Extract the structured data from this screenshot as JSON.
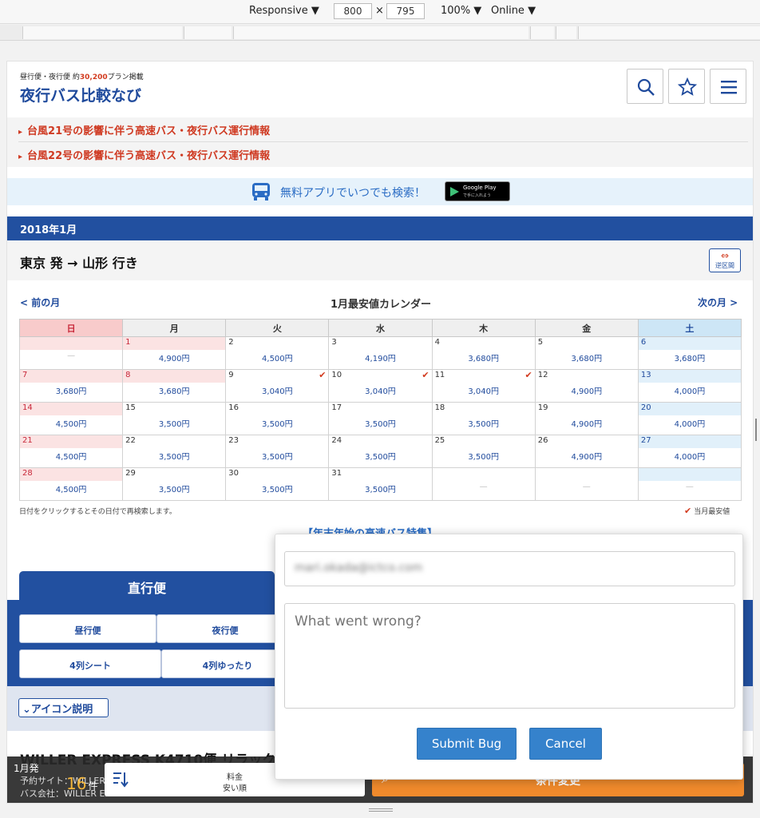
{
  "devtools": {
    "mode": "Responsive ▼",
    "width": "800",
    "height": "795",
    "times": "×",
    "zoom": "100% ▼",
    "network": "Online ▼"
  },
  "header": {
    "tagline_pre": "昼行便・夜行便 約",
    "tagline_count": "30,200",
    "tagline_post": "プラン掲載",
    "logo": "夜行バス比較なび",
    "icons": [
      "search-icon",
      "star-icon",
      "menu-icon"
    ]
  },
  "alerts": [
    "台風21号の影響に伴う高速バス・夜行バス運行情報",
    "台風22号の影響に伴う高速バス・夜行バス運行情報"
  ],
  "app_banner": {
    "text": "無料アプリでいつでも検索！",
    "store_line1": "Google Play",
    "store_line2": "で手に入れよう"
  },
  "month_label": "2018年1月",
  "route": "東京 発 → 山形 行き",
  "reverse_button": {
    "arrow": "⇔",
    "label": "逆区間"
  },
  "calendar": {
    "prev": "< 前の月",
    "next": "次の月 >",
    "title": "1月最安値カレンダー",
    "weekdays": [
      "日",
      "月",
      "火",
      "水",
      "木",
      "金",
      "土"
    ],
    "weeks": [
      [
        {
          "day": "",
          "price": "—",
          "type": "sun"
        },
        {
          "day": "1",
          "price": "4,900円",
          "type": "hol"
        },
        {
          "day": "2",
          "price": "4,500円"
        },
        {
          "day": "3",
          "price": "4,190円"
        },
        {
          "day": "4",
          "price": "3,680円"
        },
        {
          "day": "5",
          "price": "3,680円"
        },
        {
          "day": "6",
          "price": "3,680円",
          "type": "sat"
        }
      ],
      [
        {
          "day": "7",
          "price": "3,680円",
          "type": "sun"
        },
        {
          "day": "8",
          "price": "3,680円",
          "type": "hol"
        },
        {
          "day": "9",
          "price": "3,040円",
          "cheapest": true
        },
        {
          "day": "10",
          "price": "3,040円",
          "cheapest": true
        },
        {
          "day": "11",
          "price": "3,040円",
          "cheapest": true
        },
        {
          "day": "12",
          "price": "4,900円"
        },
        {
          "day": "13",
          "price": "4,000円",
          "type": "sat"
        }
      ],
      [
        {
          "day": "14",
          "price": "4,500円",
          "type": "sun"
        },
        {
          "day": "15",
          "price": "3,500円"
        },
        {
          "day": "16",
          "price": "3,500円"
        },
        {
          "day": "17",
          "price": "3,500円"
        },
        {
          "day": "18",
          "price": "3,500円"
        },
        {
          "day": "19",
          "price": "4,900円"
        },
        {
          "day": "20",
          "price": "4,000円",
          "type": "sat"
        }
      ],
      [
        {
          "day": "21",
          "price": "4,500円",
          "type": "sun"
        },
        {
          "day": "22",
          "price": "3,500円"
        },
        {
          "day": "23",
          "price": "3,500円"
        },
        {
          "day": "24",
          "price": "3,500円"
        },
        {
          "day": "25",
          "price": "3,500円"
        },
        {
          "day": "26",
          "price": "4,900円"
        },
        {
          "day": "27",
          "price": "4,000円",
          "type": "sat"
        }
      ],
      [
        {
          "day": "28",
          "price": "4,500円",
          "type": "sun"
        },
        {
          "day": "29",
          "price": "3,500円"
        },
        {
          "day": "30",
          "price": "3,500円"
        },
        {
          "day": "31",
          "price": "3,500円"
        },
        {
          "day": "",
          "price": "—"
        },
        {
          "day": "",
          "price": "—"
        },
        {
          "day": "",
          "price": "—",
          "type": "sat"
        }
      ]
    ],
    "cheapest_mark": "✔",
    "note": "日付をクリックするとその日付で再検索します。",
    "legend": "当月最安値"
  },
  "promo": "【年末年始の高速バス特集】",
  "tab_direct": "直行便",
  "filters": {
    "day_bus": "昼行便",
    "night_bus": "夜行便",
    "four_row": "4列シート",
    "four_row_relax": "4列ゆったり"
  },
  "icon_legend": "⌄アイコン説明",
  "listing_title": "WILLER EXPRESS K4710便 リラックス",
  "bottom": {
    "month": "1月発",
    "site": "予約サイト：WILLER",
    "company": "バス会社：WILLER EXPRESS",
    "count": "16",
    "count_unit": "件",
    "sort_line1": "料金",
    "sort_line2": "安い順",
    "change_conditions": "条件変更"
  },
  "bug_report": {
    "email": "mari.okada@ictco.com",
    "placeholder": "What went wrong?",
    "submit": "Submit Bug",
    "cancel": "Cancel"
  }
}
